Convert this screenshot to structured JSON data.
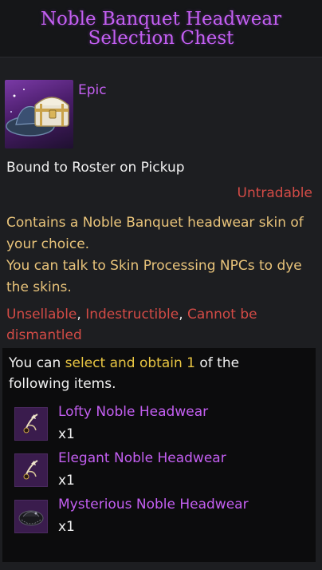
{
  "item": {
    "title": "Noble Banquet Headwear Selection Chest",
    "grade": "Epic",
    "bound": "Bound to Roster on Pickup",
    "tradable": "Untradable",
    "description_1": "Contains a Noble Banquet headwear skin of your choice.",
    "description_2": "You can talk to Skin Processing NPCs to dye the skins.",
    "restrictions": {
      "unsellable": "Unsellable",
      "indestructible": "Indestructible",
      "no_dismantle": "Cannot be dismantled",
      "separator": ", "
    },
    "icon": "treasure-chest-with-hat-icon"
  },
  "selection": {
    "intro_prefix": "You can ",
    "intro_highlight_1": "select and obtain",
    "intro_space": " ",
    "intro_highlight_2": "1",
    "intro_suffix": " of the following items.",
    "rewards": [
      {
        "name": "Lofty Noble Headwear",
        "qty": "x1",
        "icon": "feathered-headwear-icon"
      },
      {
        "name": "Elegant Noble Headwear",
        "qty": "x1",
        "icon": "feathered-headwear-icon"
      },
      {
        "name": "Mysterious Noble Headwear",
        "qty": "x1",
        "icon": "veiled-hat-icon"
      }
    ]
  },
  "colors": {
    "epic": "#c45ff2",
    "warning": "#d34b46",
    "description": "#e8c37a",
    "highlight": "#e8c542"
  }
}
